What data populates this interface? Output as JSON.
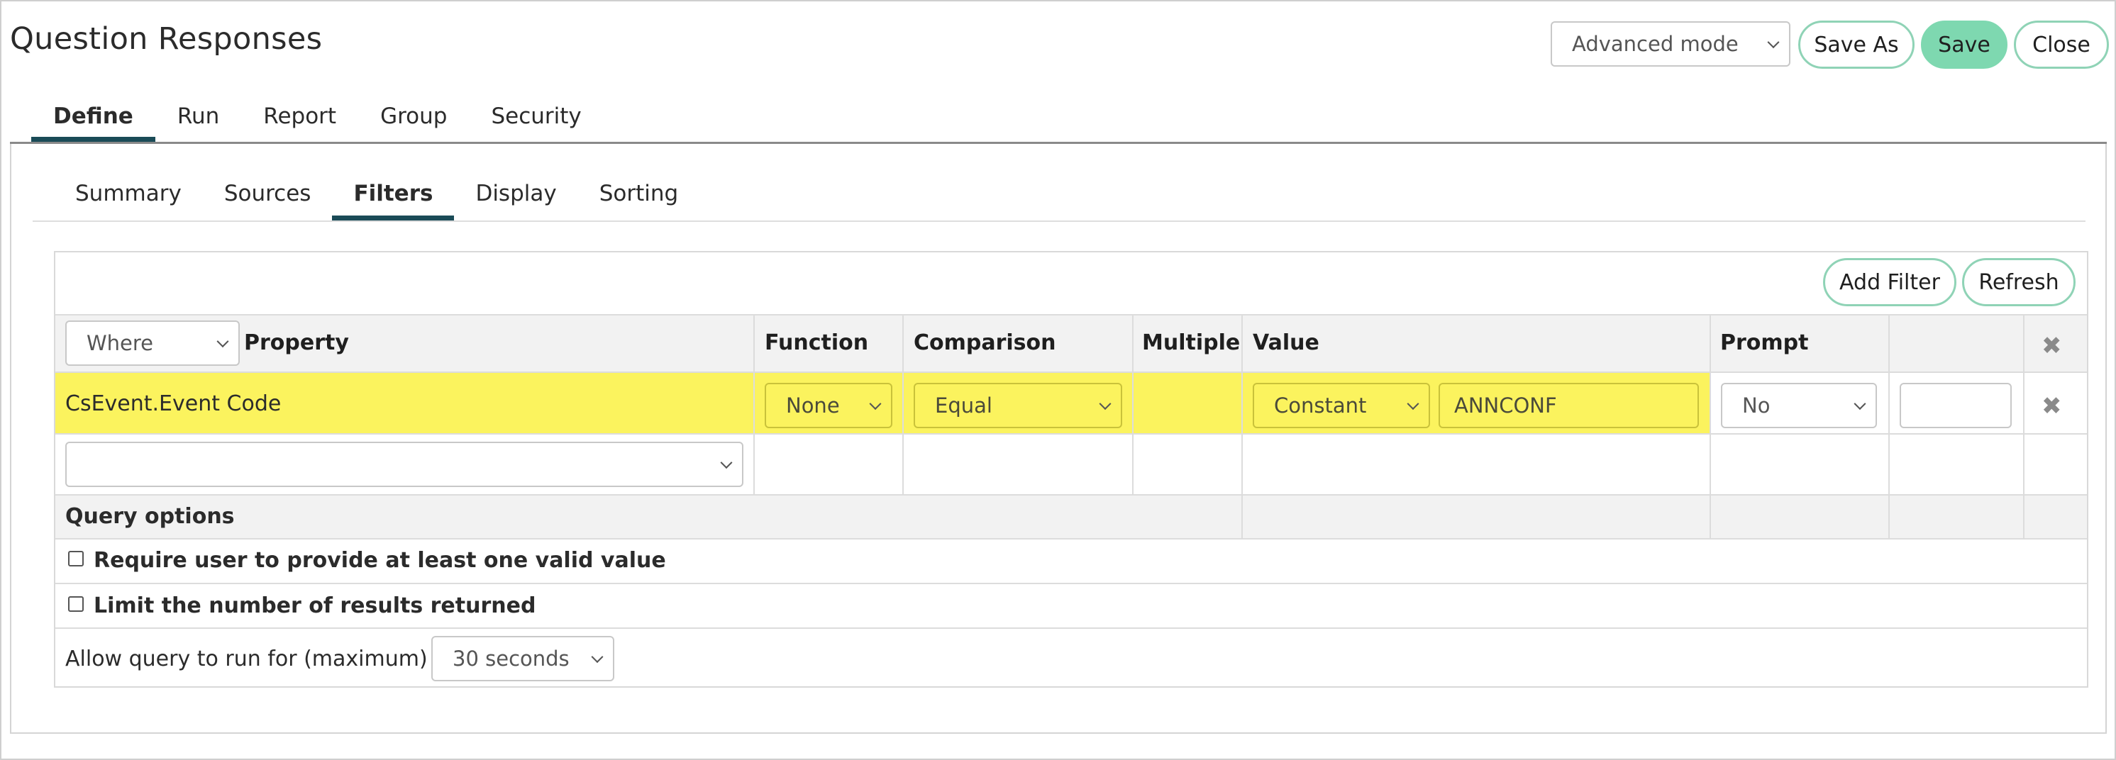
{
  "header": {
    "title": "Question Responses",
    "mode_select": "Advanced mode",
    "save_as": "Save As",
    "save": "Save",
    "close": "Close"
  },
  "main_tabs": [
    "Define",
    "Run",
    "Report",
    "Group",
    "Security"
  ],
  "main_tab_active": "Define",
  "sub_tabs": [
    "Summary",
    "Sources",
    "Filters",
    "Display",
    "Sorting"
  ],
  "sub_tab_active": "Filters",
  "toolbar": {
    "add_filter": "Add Filter",
    "refresh": "Refresh"
  },
  "columns": {
    "where_select": "Where",
    "property": "Property",
    "function": "Function",
    "comparison": "Comparison",
    "multiple": "Multiple",
    "value": "Value",
    "prompt": "Prompt"
  },
  "filter_row": {
    "property": "CsEvent.Event Code",
    "function": "None",
    "comparison": "Equal",
    "value_type": "Constant",
    "value": "ANNCONF",
    "prompt": "No",
    "extra": ""
  },
  "new_row": {
    "property_select": ""
  },
  "query_options": {
    "heading": "Query options",
    "require_valid": "Require user to provide at least one valid value",
    "require_valid_checked": false,
    "limit_results": "Limit the number of results returned",
    "limit_results_checked": false,
    "timeout_label": "Allow query to run for (maximum)",
    "timeout_value": "30 seconds"
  },
  "colors": {
    "accent_tab": "#1a4b57",
    "button_border": "#8fd3b6",
    "save_fill": "#7ed8b0",
    "highlight": "#fbf35e"
  },
  "icons": [
    "remove-row-icon",
    "remove-filter-icon",
    "chevron-down-icon"
  ]
}
